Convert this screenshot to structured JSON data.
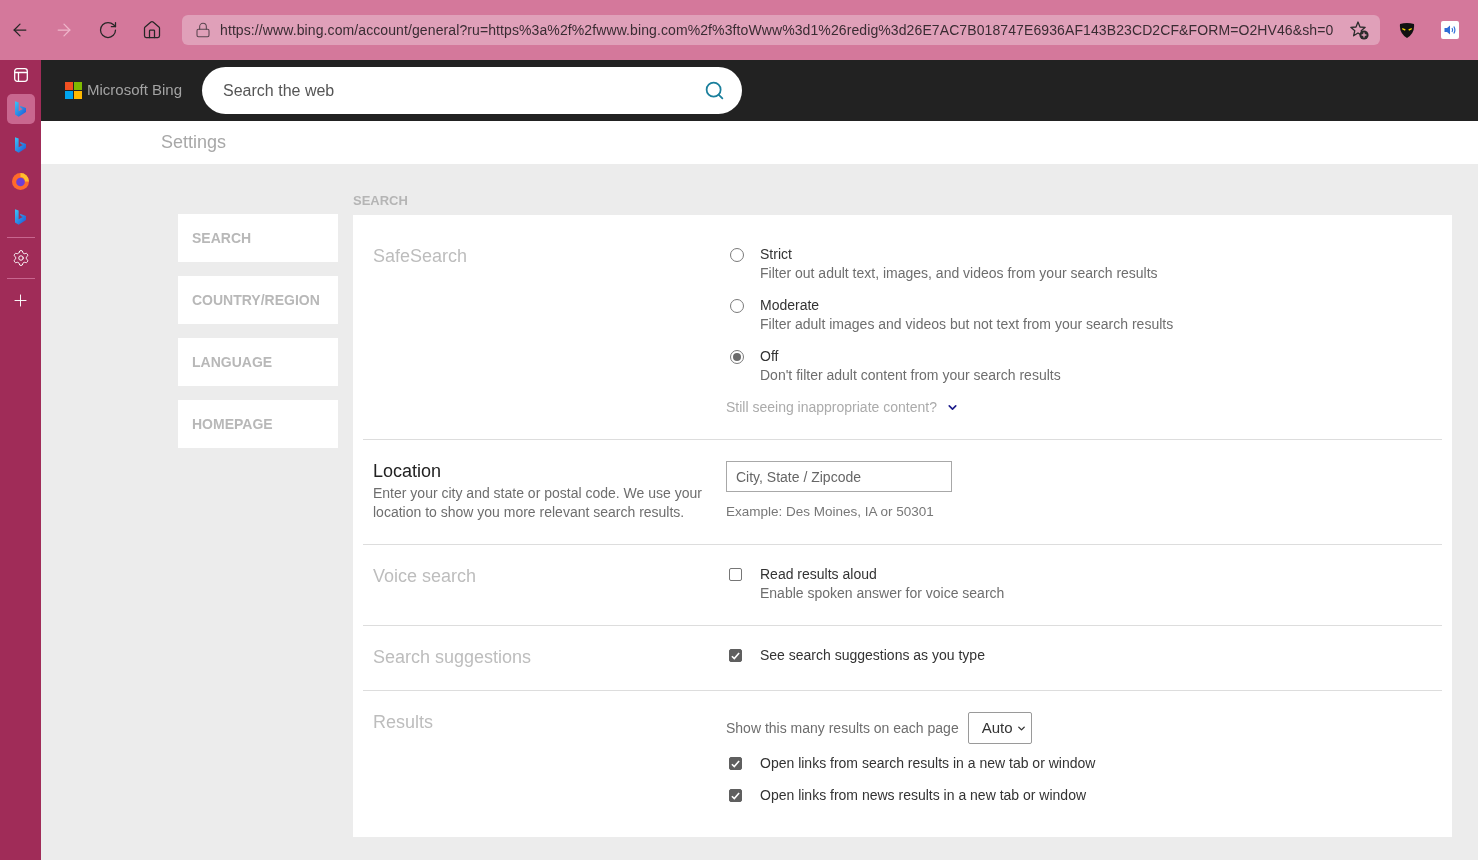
{
  "browser": {
    "nav_buttons": [
      {
        "kind": "back",
        "disabled": false
      },
      {
        "kind": "forward",
        "disabled": true
      },
      {
        "kind": "refresh",
        "disabled": false
      },
      {
        "kind": "home",
        "disabled": false
      }
    ],
    "address": "https://www.bing.com/account/general?ru=https%3a%2f%2fwww.bing.com%2f%3ftoWww%3d1%26redig%3d26E7AC7B018747E6936AF143B23CD2CF&FORM=O2HV46&sh=0"
  },
  "vertical_tabs": [
    {
      "kind": "bing",
      "selected": true
    },
    {
      "kind": "bing",
      "selected": false
    },
    {
      "kind": "firefox",
      "selected": false
    },
    {
      "kind": "bing",
      "selected": false
    }
  ],
  "header": {
    "logo_text": "Microsoft Bing",
    "search_placeholder": "Search the web"
  },
  "page_title": "Settings",
  "nav": [
    {
      "label": "SEARCH"
    },
    {
      "label": "COUNTRY/REGION"
    },
    {
      "label": "LANGUAGE"
    },
    {
      "label": "HOMEPAGE"
    }
  ],
  "section": {
    "heading": "SEARCH",
    "rows": [
      {
        "kind": "radio_group",
        "title": "SafeSearch",
        "options": [
          {
            "label": "Strict",
            "description": "Filter out adult text, images, and videos from your search results",
            "selected": false
          },
          {
            "label": "Moderate",
            "description": "Filter adult images and videos but not text from your search results",
            "selected": false
          },
          {
            "label": "Off",
            "description": "Don't filter adult content from your search results",
            "selected": true
          }
        ],
        "more_link": "Still seeing inappropriate content?"
      },
      {
        "kind": "location",
        "title": "Location",
        "description": "Enter your city and state or postal code. We use your location to show you more relevant search results.",
        "field": {
          "placeholder": "City, State / Zipcode"
        },
        "example": "Example: Des Moines, IA or 50301"
      },
      {
        "kind": "checkboxes",
        "title": "Voice search",
        "items": [
          {
            "label": "Read results aloud",
            "description": "Enable spoken answer for voice search",
            "checked": false
          }
        ]
      },
      {
        "kind": "checkboxes",
        "title": "Search suggestions",
        "items": [
          {
            "label": "See search suggestions as you type",
            "checked": true
          }
        ]
      },
      {
        "kind": "results",
        "title": "Results",
        "select": {
          "label": "Show this many results on each page",
          "value": "Auto"
        },
        "items": [
          {
            "label": "Open links from search results in a new tab or window",
            "checked": true
          },
          {
            "label": "Open links from news results in a new tab or window",
            "checked": true
          }
        ]
      }
    ]
  }
}
